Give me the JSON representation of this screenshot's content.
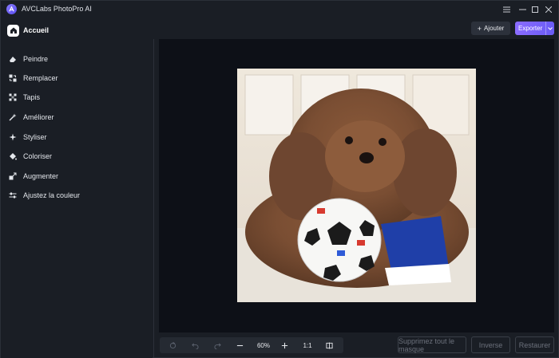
{
  "app": {
    "title": "AVCLabs PhotoPro AI"
  },
  "window_controls": {
    "menu_icon": "menu-icon",
    "minimize_icon": "minimize-icon",
    "maximize_icon": "maximize-icon",
    "close_icon": "close-icon"
  },
  "sidebar": {
    "home": {
      "label": "Accueil",
      "icon": "home-icon"
    },
    "items": [
      {
        "label": "Peindre",
        "icon": "eraser-icon"
      },
      {
        "label": "Remplacer",
        "icon": "replace-icon"
      },
      {
        "label": "Tapis",
        "icon": "cutout-icon"
      },
      {
        "label": "Améliorer",
        "icon": "enhance-icon"
      },
      {
        "label": "Styliser",
        "icon": "stylize-icon"
      },
      {
        "label": "Coloriser",
        "icon": "paint-bucket-icon"
      },
      {
        "label": "Augmenter",
        "icon": "upscale-icon"
      },
      {
        "label": "Ajustez la couleur",
        "icon": "adjust-sliders-icon"
      }
    ]
  },
  "header": {
    "add_label": "Ajouter",
    "export_label": "Exporter"
  },
  "toolbar": {
    "zoom": "60%",
    "ratio": "1:1"
  },
  "actions": {
    "remove_mask": "Supprimez tout le masque",
    "invert": "Inverse",
    "restore": "Restaurer"
  },
  "colors": {
    "background": "#1a1e25",
    "canvas": "#0d1017",
    "accent": "#7b65fb"
  }
}
